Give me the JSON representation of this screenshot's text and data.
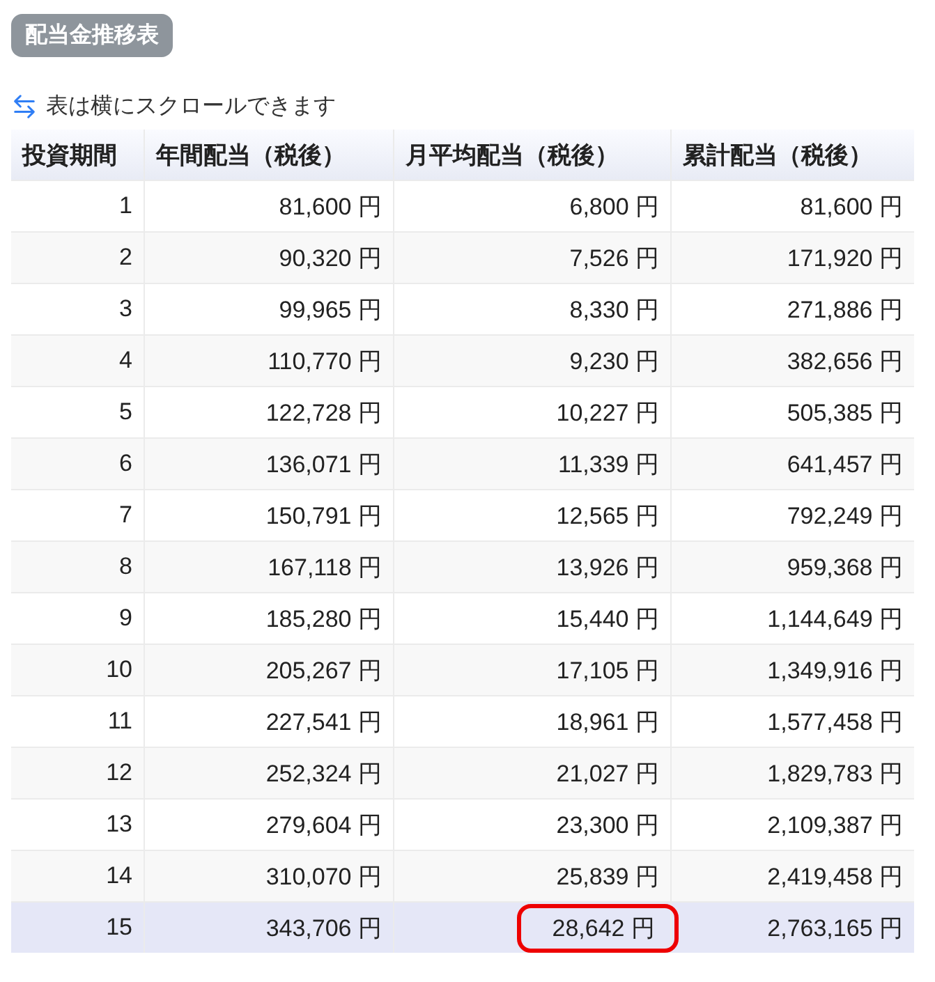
{
  "title_badge": "配当金推移表",
  "scroll_hint": "表は横にスクロールできます",
  "table": {
    "columns": [
      "投資期間",
      "年間配当（税後）",
      "月平均配当（税後）",
      "累計配当（税後）"
    ],
    "rows": [
      {
        "period": "1",
        "annual": "81,600 円",
        "monthly": "6,800 円",
        "cumulative": "81,600 円",
        "selected": false,
        "monthly_circled": false
      },
      {
        "period": "2",
        "annual": "90,320 円",
        "monthly": "7,526 円",
        "cumulative": "171,920 円",
        "selected": false,
        "monthly_circled": false
      },
      {
        "period": "3",
        "annual": "99,965 円",
        "monthly": "8,330 円",
        "cumulative": "271,886 円",
        "selected": false,
        "monthly_circled": false
      },
      {
        "period": "4",
        "annual": "110,770 円",
        "monthly": "9,230 円",
        "cumulative": "382,656 円",
        "selected": false,
        "monthly_circled": false
      },
      {
        "period": "5",
        "annual": "122,728 円",
        "monthly": "10,227 円",
        "cumulative": "505,385 円",
        "selected": false,
        "monthly_circled": false
      },
      {
        "period": "6",
        "annual": "136,071 円",
        "monthly": "11,339 円",
        "cumulative": "641,457 円",
        "selected": false,
        "monthly_circled": false
      },
      {
        "period": "7",
        "annual": "150,791 円",
        "monthly": "12,565 円",
        "cumulative": "792,249 円",
        "selected": false,
        "monthly_circled": false
      },
      {
        "period": "8",
        "annual": "167,118 円",
        "monthly": "13,926 円",
        "cumulative": "959,368 円",
        "selected": false,
        "monthly_circled": false
      },
      {
        "period": "9",
        "annual": "185,280 円",
        "monthly": "15,440 円",
        "cumulative": "1,144,649 円",
        "selected": false,
        "monthly_circled": false
      },
      {
        "period": "10",
        "annual": "205,267 円",
        "monthly": "17,105 円",
        "cumulative": "1,349,916 円",
        "selected": false,
        "monthly_circled": false
      },
      {
        "period": "11",
        "annual": "227,541 円",
        "monthly": "18,961 円",
        "cumulative": "1,577,458 円",
        "selected": false,
        "monthly_circled": false
      },
      {
        "period": "12",
        "annual": "252,324 円",
        "monthly": "21,027 円",
        "cumulative": "1,829,783 円",
        "selected": false,
        "monthly_circled": false
      },
      {
        "period": "13",
        "annual": "279,604 円",
        "monthly": "23,300 円",
        "cumulative": "2,109,387 円",
        "selected": false,
        "monthly_circled": false
      },
      {
        "period": "14",
        "annual": "310,070 円",
        "monthly": "25,839 円",
        "cumulative": "2,419,458 円",
        "selected": false,
        "monthly_circled": false
      },
      {
        "period": "15",
        "annual": "343,706 円",
        "monthly": "28,642 円",
        "cumulative": "2,763,165 円",
        "selected": true,
        "monthly_circled": true
      }
    ]
  }
}
